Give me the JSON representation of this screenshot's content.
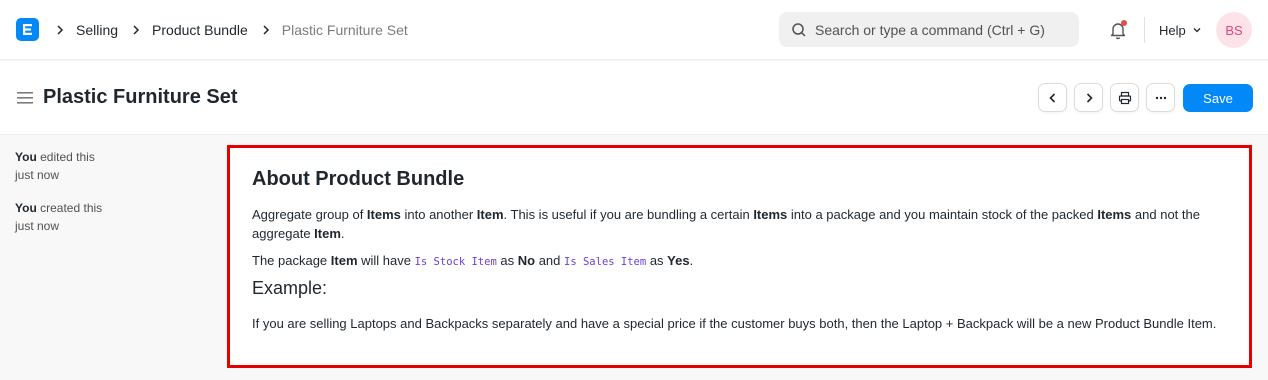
{
  "navbar": {
    "breadcrumbs": [
      "Selling",
      "Product Bundle",
      "Plastic Furniture Set"
    ],
    "search_placeholder": "Search or type a command (Ctrl + G)",
    "help_label": "Help",
    "avatar_initials": "BS"
  },
  "page": {
    "title": "Plastic Furniture Set",
    "save_label": "Save"
  },
  "timeline": [
    {
      "actor": "You",
      "action": "edited this",
      "time": "just now"
    },
    {
      "actor": "You",
      "action": "created this",
      "time": "just now"
    }
  ],
  "about": {
    "title": "About Product Bundle",
    "p1": {
      "t1": "Aggregate group of ",
      "b1": "Items",
      "t2": " into another ",
      "b2": "Item",
      "t3": ". This is useful if you are bundling a certain ",
      "b3": "Items",
      "t4": " into a package and you maintain stock of the packed ",
      "b4": "Items",
      "t5": " and not the aggregate ",
      "b5": "Item",
      "t6": "."
    },
    "p2": {
      "t1": "The package ",
      "b1": "Item",
      "t2": " will have ",
      "c1": "Is Stock Item",
      "t3": " as ",
      "b2": "No",
      "t4": " and ",
      "c2": "Is Sales Item",
      "t5": " as ",
      "b3": "Yes",
      "t6": "."
    },
    "example_title": "Example:",
    "example_text": "If you are selling Laptops and Backpacks separately and have a special price if the customer buys both, then the Laptop + Backpack will be a new Product Bundle Item."
  },
  "colors": {
    "accent": "#0289f7",
    "highlight_border": "#e60000",
    "code_text": "#6c3fd8"
  }
}
